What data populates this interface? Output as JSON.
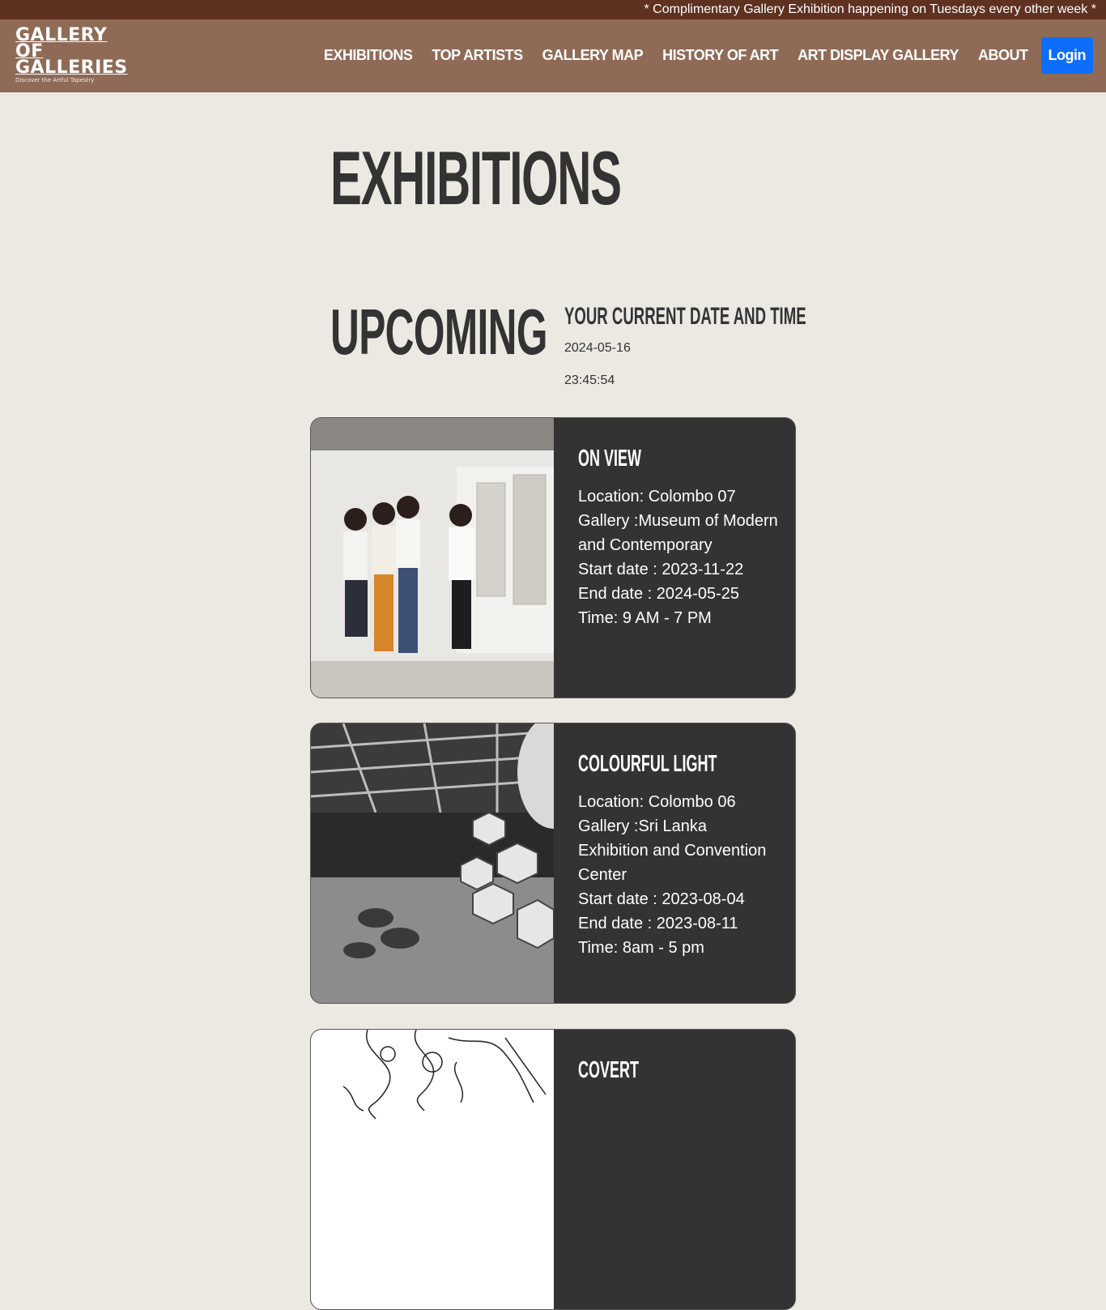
{
  "ticker": {
    "text": "* Complimentary Gallery Exhibition happening on Tuesdays every other week *"
  },
  "brand": {
    "line1": "GALLERY",
    "line2": "OF",
    "line3": "GALLERIES",
    "tagline": "Discover the Artful Tapestry"
  },
  "nav": {
    "items": [
      {
        "label": "EXHIBITIONS"
      },
      {
        "label": "TOP ARTISTS"
      },
      {
        "label": "GALLERY MAP"
      },
      {
        "label": "HISTORY OF ART"
      },
      {
        "label": "ART DISPLAY GALLERY"
      },
      {
        "label": "ABOUT"
      }
    ],
    "login_label": "Login"
  },
  "page": {
    "title": "EXHIBITIONS",
    "section_title": "UPCOMING"
  },
  "datetime": {
    "heading": "YOUR CURRENT DATE AND TIME",
    "date": "2024-05-16",
    "time": "23:45:54"
  },
  "exhibitions": [
    {
      "title": "ON VIEW",
      "location": "Location: Colombo 07",
      "gallery": "Gallery :Museum of Modern and Contemporary",
      "start": "Start date : 2023-11-22",
      "end": "End date : 2024-05-25",
      "time": "Time: 9 AM - 7 PM"
    },
    {
      "title": "COLOURFUL LIGHT",
      "location": "Location: Colombo 06",
      "gallery": "Gallery :Sri Lanka Exhibition and Convention Center",
      "start": "Start date : 2023-08-04",
      "end": "End date : 2023-08-11",
      "time": "Time: 8am - 5 pm"
    },
    {
      "title": "COVERT"
    }
  ],
  "colors": {
    "ticker_bg": "#5e3121",
    "nav_bg": "#8f6b57",
    "page_bg": "#ebe9e2",
    "card_bg": "#333333",
    "login_bg": "#0d6efd"
  }
}
